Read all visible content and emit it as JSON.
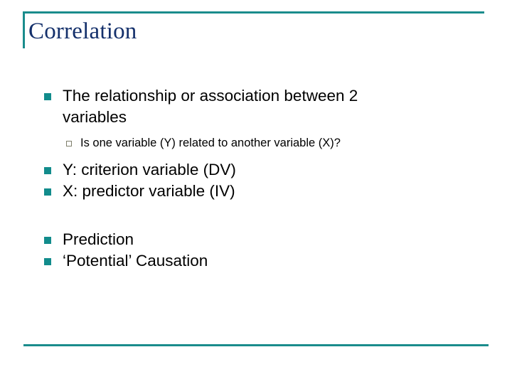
{
  "slide": {
    "title": "Correlation",
    "theme": {
      "accent_teal": "#128C8C",
      "title_navy": "#14306B",
      "body_black": "#000000",
      "sub_marker_gray": "#7F7F6B",
      "background": "#ffffff"
    },
    "bullets": [
      {
        "level": 1,
        "marker": "filled-square-bullet",
        "text": "The relationship or association between 2 variables"
      },
      {
        "level": 2,
        "marker": "hollow-square-bullet",
        "text": "Is one variable (Y) related to another variable (X)?"
      },
      {
        "level": 1,
        "marker": "filled-square-bullet",
        "text": "Y: criterion variable (DV)"
      },
      {
        "level": 1,
        "marker": "filled-square-bullet",
        "text": "X: predictor variable (IV)"
      },
      {
        "level": 1,
        "marker": "filled-square-bullet",
        "text": "Prediction"
      },
      {
        "level": 1,
        "marker": "filled-square-bullet",
        "text": "‘Potential’ Causation"
      }
    ]
  }
}
